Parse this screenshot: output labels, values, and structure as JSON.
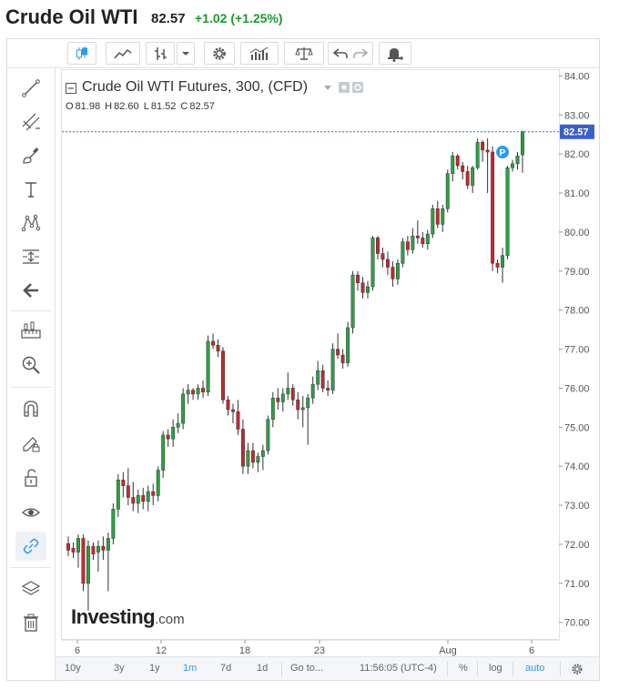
{
  "header": {
    "title": "Crude Oil WTI",
    "price": "82.57",
    "change": "+1.02 (+1.25%)"
  },
  "legend": {
    "title": "Crude Oil WTI Futures, 300, (CFD)",
    "open_label": "O",
    "open": "81.98",
    "high_label": "H",
    "high": "82.60",
    "low_label": "L",
    "low": "81.52",
    "close_label": "C",
    "close": "82.57"
  },
  "logo": {
    "main": "Investing",
    "suffix": ".com"
  },
  "price_tag": "82.57",
  "marker_label": "P",
  "bottom_bar": {
    "ranges": [
      "10y",
      "3y",
      "1y",
      "1m",
      "7d",
      "1d"
    ],
    "selected": "1m",
    "goto": "Go to...",
    "time": "11:56:05 (UTC-4)",
    "percent": "%",
    "log": "log",
    "auto": "auto"
  },
  "colors": {
    "up": "#2ea043",
    "down": "#c3292e",
    "accent": "#2d9bf0",
    "price_line": "#3a5fcd"
  },
  "toolbar_icons": [
    "candles-icon",
    "line-chart-icon",
    "bar-type-icon",
    "dropdown-arrow-icon",
    "settings-icon",
    "indicators-icon",
    "compare-icon",
    "undo-icon",
    "redo-icon",
    "alert-icon"
  ],
  "sidebar_icons": [
    "trend-line-icon",
    "fib-tools-icon",
    "brush-icon",
    "text-icon",
    "pattern-icon",
    "measure-icon",
    "back-arrow-icon",
    "ruler-icon",
    "zoom-in-icon",
    "magnet-icon",
    "lock-drawing-icon",
    "unlock-icon",
    "eye-icon",
    "link-icon",
    "layers-icon",
    "trash-icon"
  ],
  "chart_data": {
    "type": "candlestick",
    "y_ticks": [
      "84.00",
      "83.00",
      "82.00",
      "81.00",
      "80.00",
      "79.00",
      "78.00",
      "77.00",
      "76.00",
      "75.00",
      "74.00",
      "73.00",
      "72.00",
      "71.00",
      "70.00"
    ],
    "x_ticks": [
      "6",
      "12",
      "18",
      "23",
      "Aug",
      "6"
    ],
    "ylim": [
      69.55,
      84.15
    ],
    "last_price": 82.57,
    "candles": [
      [
        72.02,
        72.2,
        71.7,
        71.85
      ],
      [
        71.9,
        72.05,
        71.65,
        71.8
      ],
      [
        71.8,
        72.25,
        71.4,
        72.15
      ],
      [
        72.15,
        72.25,
        70.8,
        71.0
      ],
      [
        71.0,
        72.1,
        70.3,
        71.95
      ],
      [
        71.95,
        72.05,
        71.6,
        71.75
      ],
      [
        71.8,
        72.1,
        71.3,
        71.95
      ],
      [
        71.95,
        72.2,
        71.6,
        71.85
      ],
      [
        71.85,
        72.3,
        70.8,
        72.15
      ],
      [
        72.15,
        73.05,
        72.0,
        72.9
      ],
      [
        72.9,
        73.8,
        72.7,
        73.65
      ],
      [
        73.65,
        73.85,
        73.2,
        73.5
      ],
      [
        73.5,
        73.95,
        73.0,
        73.2
      ],
      [
        73.2,
        73.6,
        72.85,
        73.05
      ],
      [
        73.05,
        73.4,
        72.8,
        73.25
      ],
      [
        73.25,
        73.45,
        72.9,
        73.1
      ],
      [
        73.1,
        73.5,
        72.85,
        73.35
      ],
      [
        73.35,
        73.55,
        73.0,
        73.25
      ],
      [
        73.25,
        74.0,
        73.1,
        73.9
      ],
      [
        73.9,
        74.9,
        73.7,
        74.8
      ],
      [
        74.8,
        74.95,
        74.5,
        74.7
      ],
      [
        74.7,
        75.2,
        74.5,
        75.0
      ],
      [
        75.0,
        75.35,
        74.85,
        75.1
      ],
      [
        75.1,
        76.0,
        74.95,
        75.85
      ],
      [
        75.85,
        76.1,
        75.6,
        75.95
      ],
      [
        75.95,
        76.0,
        75.7,
        75.85
      ],
      [
        75.85,
        76.1,
        75.7,
        76.0
      ],
      [
        76.0,
        76.2,
        75.75,
        75.9
      ],
      [
        75.9,
        77.35,
        75.8,
        77.2
      ],
      [
        77.2,
        77.4,
        77.0,
        77.1
      ],
      [
        77.1,
        77.25,
        76.8,
        76.95
      ],
      [
        76.95,
        77.05,
        75.6,
        75.7
      ],
      [
        75.7,
        75.8,
        75.3,
        75.45
      ],
      [
        75.45,
        75.6,
        75.1,
        75.4
      ],
      [
        75.4,
        75.7,
        74.8,
        74.95
      ],
      [
        74.95,
        75.2,
        73.8,
        74.0
      ],
      [
        74.0,
        74.6,
        73.8,
        74.4
      ],
      [
        74.4,
        74.6,
        73.95,
        74.1
      ],
      [
        74.1,
        74.35,
        73.85,
        74.25
      ],
      [
        74.25,
        74.55,
        73.9,
        74.4
      ],
      [
        74.4,
        75.3,
        74.3,
        75.2
      ],
      [
        75.2,
        75.9,
        75.0,
        75.75
      ],
      [
        75.75,
        76.0,
        75.45,
        75.65
      ],
      [
        75.65,
        76.0,
        75.4,
        75.85
      ],
      [
        75.85,
        76.4,
        75.7,
        76.0
      ],
      [
        76.0,
        76.1,
        75.55,
        75.7
      ],
      [
        75.7,
        75.9,
        75.2,
        75.45
      ],
      [
        75.45,
        75.8,
        75.0,
        75.5
      ],
      [
        75.5,
        75.85,
        74.55,
        75.75
      ],
      [
        75.75,
        76.3,
        75.6,
        76.1
      ],
      [
        76.1,
        76.7,
        75.95,
        76.45
      ],
      [
        76.45,
        76.6,
        75.9,
        76.0
      ],
      [
        76.0,
        76.2,
        75.8,
        75.95
      ],
      [
        75.95,
        77.15,
        75.85,
        77.0
      ],
      [
        77.0,
        77.4,
        76.75,
        76.85
      ],
      [
        76.85,
        77.0,
        76.5,
        76.65
      ],
      [
        76.65,
        77.7,
        76.55,
        77.55
      ],
      [
        77.55,
        79.0,
        77.4,
        78.9
      ],
      [
        78.9,
        79.0,
        78.5,
        78.7
      ],
      [
        78.7,
        78.85,
        78.3,
        78.45
      ],
      [
        78.45,
        78.75,
        78.3,
        78.6
      ],
      [
        78.6,
        79.9,
        78.5,
        79.85
      ],
      [
        79.85,
        79.9,
        79.3,
        79.45
      ],
      [
        79.45,
        79.6,
        79.1,
        79.3
      ],
      [
        79.3,
        79.5,
        78.9,
        79.1
      ],
      [
        79.1,
        79.25,
        78.6,
        78.8
      ],
      [
        78.8,
        79.3,
        78.65,
        79.2
      ],
      [
        79.2,
        79.85,
        79.1,
        79.75
      ],
      [
        79.75,
        79.9,
        79.4,
        79.55
      ],
      [
        79.55,
        80.1,
        79.45,
        79.9
      ],
      [
        79.9,
        80.3,
        79.7,
        79.85
      ],
      [
        79.85,
        80.0,
        79.6,
        79.7
      ],
      [
        79.7,
        80.05,
        79.55,
        79.95
      ],
      [
        79.95,
        80.7,
        79.85,
        80.6
      ],
      [
        80.6,
        80.8,
        80.1,
        80.2
      ],
      [
        80.2,
        80.7,
        80.0,
        80.6
      ],
      [
        80.6,
        81.6,
        80.5,
        81.5
      ],
      [
        81.5,
        82.05,
        81.3,
        81.95
      ],
      [
        81.95,
        82.0,
        81.6,
        81.7
      ],
      [
        81.7,
        81.8,
        81.35,
        81.55
      ],
      [
        81.55,
        81.7,
        81.1,
        81.2
      ],
      [
        81.2,
        81.7,
        81.0,
        81.65
      ],
      [
        81.65,
        82.4,
        81.6,
        82.3
      ],
      [
        82.3,
        82.35,
        81.8,
        82.1
      ],
      [
        82.1,
        82.4,
        81.0,
        82.05
      ],
      [
        82.05,
        82.2,
        79.0,
        79.2
      ],
      [
        79.2,
        79.3,
        78.95,
        79.1
      ],
      [
        79.1,
        79.6,
        78.7,
        79.4
      ],
      [
        79.4,
        81.7,
        79.3,
        81.65
      ],
      [
        81.65,
        81.85,
        81.55,
        81.75
      ],
      [
        81.75,
        82.05,
        81.6,
        81.95
      ],
      [
        81.98,
        82.6,
        81.52,
        82.57
      ]
    ]
  }
}
